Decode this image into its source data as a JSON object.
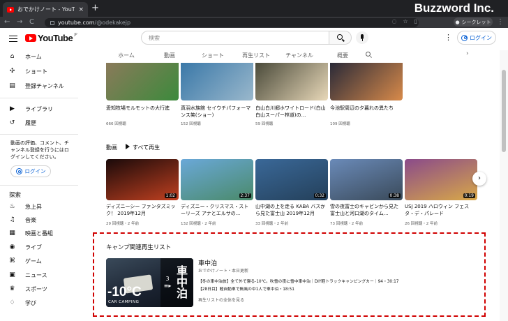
{
  "browser": {
    "tab_title": "おでかけノート - YouTube",
    "tab_close": "×",
    "new_tab": "+",
    "url_host": "youtube.com",
    "url_path": "/@odekakejp",
    "brand": "Buzzword Inc.",
    "secret_label": "シークレット",
    "nav_back": "←",
    "nav_forward": "→",
    "nav_reload": "C",
    "menu": "⋮"
  },
  "header": {
    "logo_text": "YouTube",
    "logo_jp": "JP",
    "search_placeholder": "検索",
    "kebab": "⋮",
    "login": "ログイン"
  },
  "tabs": [
    "ホーム",
    "動画",
    "ショート",
    "再生リスト",
    "チャンネル",
    "概要"
  ],
  "tabs_next": "›",
  "sidebar": {
    "items": [
      {
        "label": "ホーム",
        "icon": "⌂"
      },
      {
        "label": "ショート",
        "icon": "✣"
      },
      {
        "label": "登録チャンネル",
        "icon": "▤"
      }
    ],
    "items2": [
      {
        "label": "ライブラリ",
        "icon": "▶"
      },
      {
        "label": "履歴",
        "icon": "↺"
      }
    ],
    "message": "動画の評価、コメント、チャンネル登録を行うにはログインしてください。",
    "login": "ログイン",
    "explore_heading": "探索",
    "explore": [
      {
        "label": "急上昇",
        "icon": "♨"
      },
      {
        "label": "音楽",
        "icon": "♫"
      },
      {
        "label": "映画と番組",
        "icon": "▦"
      },
      {
        "label": "ライブ",
        "icon": "◉"
      },
      {
        "label": "ゲーム",
        "icon": "⌘"
      },
      {
        "label": "ニュース",
        "icon": "▣"
      },
      {
        "label": "スポーツ",
        "icon": "♛"
      },
      {
        "label": "学び",
        "icon": "♢"
      }
    ]
  },
  "shorts": [
    {
      "title": "愛知牧場モルモットの大行進",
      "meta": "666 回視聴",
      "color1": "#8a7a5a",
      "color2": "#3c8a3c"
    },
    {
      "title": "真羽水族館 セイウチパフォーマンス笑(ショー)",
      "meta": "152 回視聴",
      "color1": "#3a78a8",
      "color2": "#9ab8cc"
    },
    {
      "title": "白山白川郷ホワイトロード(白山白山スーパー林道)の...",
      "meta": "59 回視聴",
      "color1": "#4a4a3a",
      "color2": "#e8d8b8"
    },
    {
      "title": "今池駅周辺の夕暮れの異たち",
      "meta": "109 回視聴",
      "color1": "#2a2a38",
      "color2": "#d88a4a"
    }
  ],
  "videos_section": {
    "title": "動画",
    "play_all": "すべて再生",
    "next": "›"
  },
  "videos": [
    {
      "title": "ディズニーシー ファンタズミック！ 2019年12月",
      "meta": "29 回視聴・2 年前",
      "duration": "1:02",
      "color1": "#1a0a0a",
      "color2": "#c04020"
    },
    {
      "title": "ディズニー・クリスマス・ストーリーズ アナとエルサの...",
      "meta": "132 回視聴・2 年前",
      "duration": "2:37",
      "color1": "#6aa8d8",
      "color2": "#4a8a6a"
    },
    {
      "title": "山中湖の上を走る KABA バスから見た富士山 2019年12月",
      "meta": "33 回視聴・2 年前",
      "duration": "0:32",
      "color1": "#3a6898",
      "color2": "#24405a"
    },
    {
      "title": "雪の夜富士のキャビンから見た富士山と河口湖のタイム...",
      "meta": "73 回視聴・2 年前",
      "duration": "0:38",
      "color1": "#6a8ab8",
      "color2": "#3a4a5a"
    },
    {
      "title": "USJ 2019 ハロウィン フェスタ・デ・パレード",
      "meta": "26 回視聴・2 年前",
      "duration": "0:19",
      "color1": "#8a4a8a",
      "color2": "#d8a848"
    }
  ],
  "playlist": {
    "heading": "キャンプ関連再生リスト",
    "title": "車中泊",
    "meta": "おでかけノート・本日更新",
    "count": "3",
    "thumb_big": "-10°C",
    "thumb_small": "CAR CAMPING",
    "thumb_side": "車中泊",
    "rows": [
      "【冬の車中泊旅】全て外で寝る-10℃。吹雪の夜に雪中車中泊｜DIY軽トラックキャンピングカー｜94・30:17",
      "【28日目】軽自動車で無風の中1人で車中泊・18:51"
    ],
    "view_all": "再生リストの全体を見る"
  }
}
